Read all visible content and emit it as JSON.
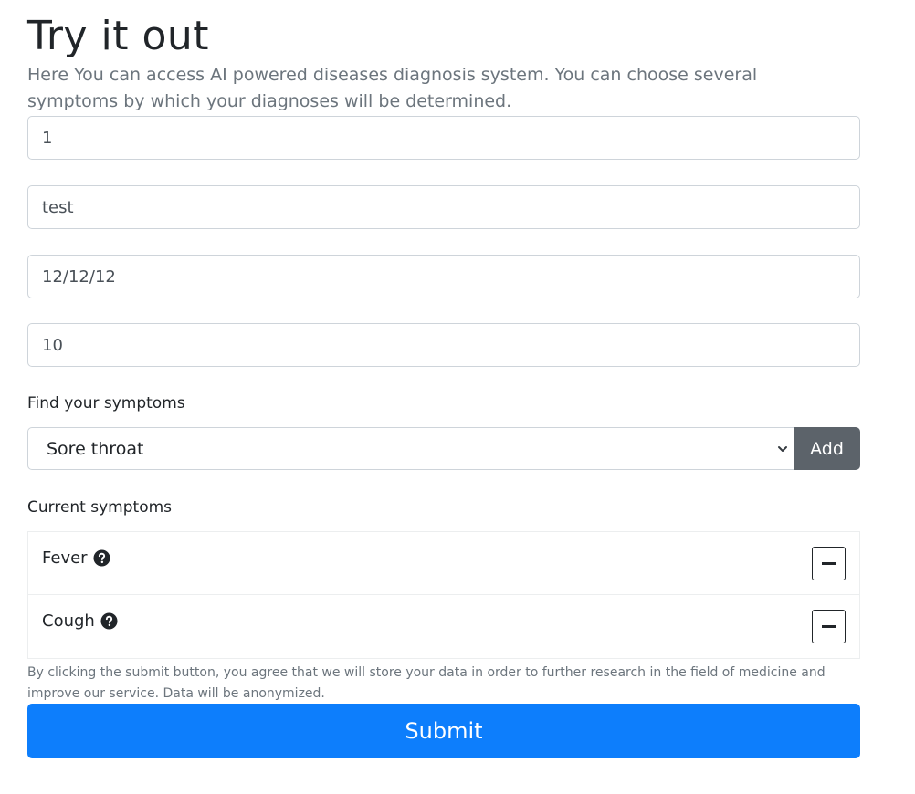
{
  "header": {
    "title": "Try it out",
    "intro": "Here You can access AI powered diseases diagnosis system. You can choose several symptoms by which your diagnoses will be determined."
  },
  "form": {
    "fields": [
      {
        "value": "1"
      },
      {
        "value": "test"
      },
      {
        "value": "12/12/12"
      },
      {
        "value": "10"
      }
    ],
    "find_label": "Find your symptoms",
    "symptom_select": {
      "selected": "Sore throat"
    },
    "add_label": "Add",
    "current_label": "Current symptoms",
    "current_symptoms": [
      {
        "name": "Fever",
        "help_icon": "question-circle-icon",
        "remove_icon": "minus-icon"
      },
      {
        "name": "Cough",
        "help_icon": "question-circle-icon",
        "remove_icon": "minus-icon"
      }
    ],
    "consent": "By clicking the submit button, you agree that we will store your data in order to further research in the field of medicine and improve our service. Data will be anonymized.",
    "submit_label": "Submit"
  },
  "colors": {
    "primary": "#0d7efc",
    "secondary": "#5c636a",
    "muted": "#6c757d",
    "text": "#212529"
  }
}
